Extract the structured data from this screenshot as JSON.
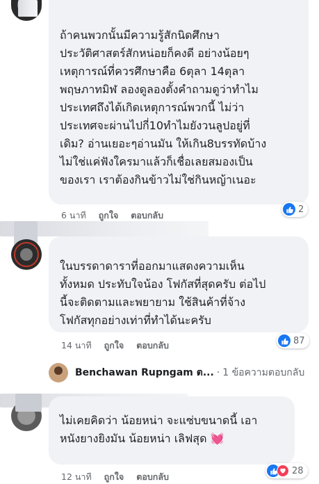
{
  "comments": [
    {
      "text": "ถ้าคนพวกนั้นมีความรู้สักนิดศึกษา\nประวัติศาสตร์สักหน่อยก็คงดี อย่างน้อยๆ\nเหตุการณ์ที่ควรศึกษาคือ 6ตุลา 14ตุลา\nพฤษภาทมิฬ ลองดูลองตั้งคำถามดูว่าทำไม\nประเทศถึงได้เกิดเหตุการณ์พวกนี้ ไม่ว่า\nประเทศจะผ่านไปกี่10ทำไมยังวนลูปอยู่ที่\nเดิม? อ่านเยอะๆอ่านมัน ให้เกิน8บรรทัดบ้าง\nไม่ใช่แค่ฟังใครมาแล้วก็เชื่อเลยสมองเป็น\nของเรา เราต้องกินข้าวไม่ใช่กินหญ้าเนอะ",
      "time": "6 นาที",
      "like_label": "ถูกใจ",
      "reply_label": "ตอบกลับ",
      "reaction_count": "2",
      "reactions": [
        "like-icon"
      ]
    },
    {
      "text": "ในบรรดาดาราที่ออกมาแสดงความเห็น\nทั้งหมด ประทับใจน้อง โฟกัสที่สุดครับ ต่อไป\nนี้จะติดตามและพยายาม ใช้สินค้าที่จ้าง\nโฟกัสทุกอย่างเท่าที่ทำได้นะครับ",
      "time": "14 นาที",
      "like_label": "ถูกใจ",
      "reply_label": "ตอบกลับ",
      "reaction_count": "87",
      "reactions": [
        "like-icon"
      ]
    },
    {
      "text": "ไม่เคยคิดว่า น้อยหน่า จะแซ่บขนาดนี้ เอา\nหนังยางยิงมัน น้อยหน่า เลิฟสุด 💓",
      "time": "12 นาที",
      "like_label": "ถูกใจ",
      "reply_label": "ตอบกลับ",
      "reaction_count": "28",
      "reactions": [
        "like-icon",
        "heart-icon"
      ]
    }
  ],
  "reply_preview": {
    "name": "Benchawan Rupngam ต...",
    "separator": "·",
    "count_text": "1 ข้อความตอบกลับ"
  },
  "colors": {
    "bubble": "#f0f2f5",
    "meta": "#65676b",
    "like": "#1877f2",
    "love": "#f33e58"
  }
}
